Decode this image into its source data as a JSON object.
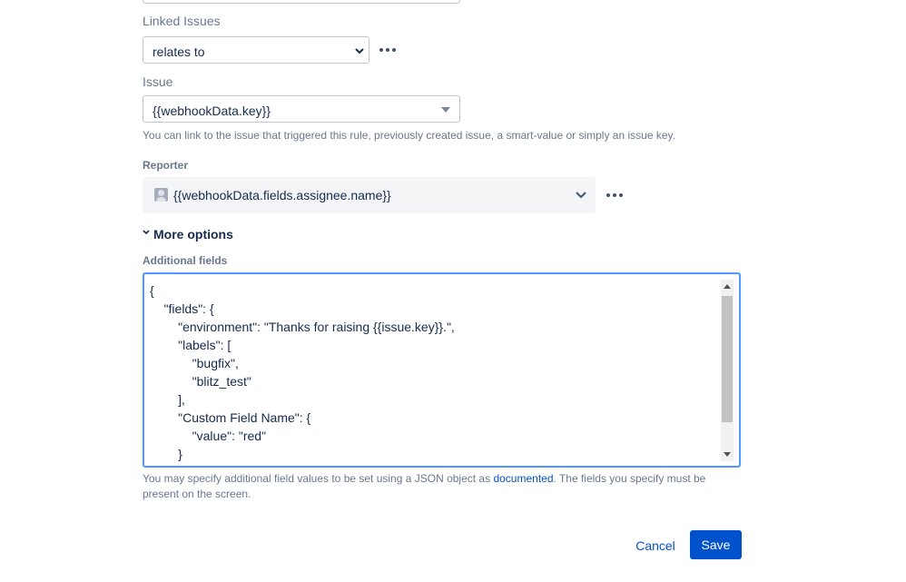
{
  "linked_issues": {
    "label": "Linked Issues",
    "value": "relates to"
  },
  "issue": {
    "label": "Issue",
    "value": "{{webhookData.key}}",
    "hint": "You can link to the issue that triggered this rule, previously created issue, a smart-value or simply an issue key."
  },
  "reporter": {
    "label": "Reporter",
    "value": "{{webhookData.fields.assignee.name}}"
  },
  "more_options": {
    "label": "More options"
  },
  "additional_fields": {
    "label": "Additional fields",
    "value": "{\n    \"fields\": {\n        \"environment\": \"Thanks for raising {{issue.key}}.\",\n        \"labels\": [\n            \"bugfix\",\n            \"blitz_test\"\n        ],\n        \"Custom Field Name\": {\n            \"value\": \"red\"\n        }",
    "hint_before": "You may specify additional field values to be set using a JSON object as ",
    "hint_link": "documented",
    "hint_after": ". The fields you specify must be present on the screen."
  },
  "actions": {
    "cancel_label": "Cancel",
    "save_label": "Save"
  },
  "icons": {
    "dropdown": "chevron-down-icon",
    "more": "more-horizontal-icon",
    "avatar": "user-avatar-icon"
  },
  "colors": {
    "primary": "#0052cc",
    "focus_border": "#4c9aff",
    "text": "#172b4d",
    "subtle_text": "#6b778c"
  }
}
